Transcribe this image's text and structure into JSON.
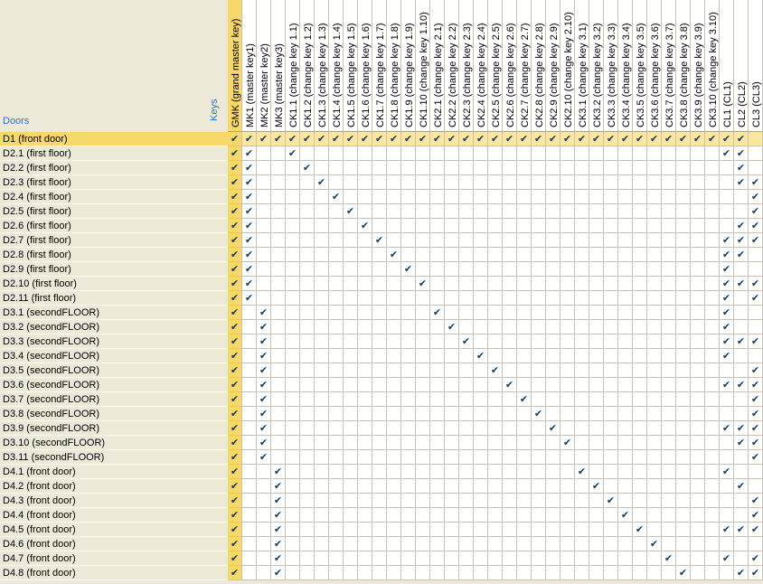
{
  "window": {
    "title": ""
  },
  "headers": {
    "doors_label": "Doors",
    "keys_label": "Keys"
  },
  "colors": {
    "accent": "#f6d86b",
    "header_text": "#2f73c4",
    "check": "#17385f"
  },
  "key_columns": [
    "GMK (grand master key)",
    "MK1 (master key1)",
    "MK2 (master key2)",
    "MK3 (master key3)",
    "CK1.1 (change key 1.1)",
    "CK1.2 (change key 1.2)",
    "CK1.3 (change key 1.3)",
    "CK1.4 (change key 1.4)",
    "CK1.5 (change key 1.5)",
    "CK1.6 (change key 1.6)",
    "CK1.7 (change key 1.7)",
    "CK1.8 (change key 1.8)",
    "CK1.9 (change key 1.9)",
    "CK1.10 (change key 1.10)",
    "CK2.1 (change key 2.1)",
    "CK2.2 (change key 2.2)",
    "CK2.3 (change key 2.3)",
    "CK2.4 (change key 2.4)",
    "CK2.5 (change key 2.5)",
    "CK2.6 (change key 2.6)",
    "CK2.7 (change key 2.7)",
    "CK2.8 (change key 2.8)",
    "CK2.9 (change key 2.9)",
    "CK2.10 (change key 2.10)",
    "CK3.1 (change key 3.1)",
    "CK3.2 (change key 3.2)",
    "CK3.3 (change key 3.3)",
    "CK3.4 (change key 3.4)",
    "CK3.5 (change key 3.5)",
    "CK3.6 (change key 3.6)",
    "CK3.7 (change key 3.7)",
    "CK3.8 (change key 3.8)",
    "CK3.9 (change key 3.9)",
    "CK3.10 (change key 3.10)",
    "CL1 (CL1)",
    "CL2 (CL2)",
    "CL3 (CL3)"
  ],
  "rows": [
    {
      "door": "D1 (front door)",
      "selected": true,
      "checks": [
        0,
        1,
        2,
        3,
        4,
        5,
        6,
        7,
        8,
        9,
        10,
        11,
        12,
        13,
        14,
        15,
        16,
        17,
        18,
        19,
        20,
        21,
        22,
        23,
        24,
        25,
        26,
        27,
        28,
        29,
        30,
        31,
        32,
        33,
        34,
        35
      ]
    },
    {
      "door": "D2.1 (first floor)",
      "checks": [
        0,
        1,
        4,
        34,
        35
      ]
    },
    {
      "door": "D2.2 (first floor)",
      "checks": [
        0,
        1,
        5,
        35
      ]
    },
    {
      "door": "D2.3 (first floor)",
      "checks": [
        0,
        1,
        6,
        35,
        36
      ]
    },
    {
      "door": "D2.4 (first floor)",
      "checks": [
        0,
        1,
        7,
        36
      ]
    },
    {
      "door": "D2.5 (first floor)",
      "checks": [
        0,
        1,
        8,
        36
      ]
    },
    {
      "door": "D2.6 (first floor)",
      "checks": [
        0,
        1,
        9,
        35,
        36
      ]
    },
    {
      "door": "D2.7 (first floor)",
      "checks": [
        0,
        1,
        10,
        34,
        35,
        36
      ]
    },
    {
      "door": "D2.8 (first floor)",
      "checks": [
        0,
        1,
        11,
        34,
        35
      ]
    },
    {
      "door": "D2.9 (first floor)",
      "checks": [
        0,
        1,
        12,
        34
      ]
    },
    {
      "door": "D2.10 (first floor)",
      "checks": [
        0,
        1,
        13,
        34,
        35,
        36
      ]
    },
    {
      "door": "D2.11 (first floor)",
      "checks": [
        0,
        1,
        34,
        36
      ]
    },
    {
      "door": "D3.1 (secondFLOOR)",
      "checks": [
        0,
        2,
        14,
        34
      ]
    },
    {
      "door": "D3.2 (secondFLOOR)",
      "checks": [
        0,
        2,
        15,
        34
      ]
    },
    {
      "door": "D3.3 (secondFLOOR)",
      "checks": [
        0,
        2,
        16,
        34,
        35,
        36
      ]
    },
    {
      "door": "D3.4 (secondFLOOR)",
      "checks": [
        0,
        2,
        17,
        34
      ]
    },
    {
      "door": "D3.5 (secondFLOOR)",
      "checks": [
        0,
        2,
        18,
        36
      ]
    },
    {
      "door": "D3.6 (secondFLOOR)",
      "checks": [
        0,
        2,
        19,
        34,
        35,
        36
      ]
    },
    {
      "door": "D3.7 (secondFLOOR)",
      "checks": [
        0,
        2,
        20,
        36
      ]
    },
    {
      "door": "D3.8 (secondFLOOR)",
      "checks": [
        0,
        2,
        21,
        36
      ]
    },
    {
      "door": "D3.9 (secondFLOOR)",
      "checks": [
        0,
        2,
        22,
        34,
        35,
        36
      ]
    },
    {
      "door": "D3.10 (secondFLOOR)",
      "checks": [
        0,
        2,
        23,
        35,
        36
      ]
    },
    {
      "door": "D3.11 (secondFLOOR)",
      "checks": [
        0,
        2,
        36
      ]
    },
    {
      "door": "D4.1 (front door)",
      "checks": [
        0,
        3,
        24,
        34
      ]
    },
    {
      "door": "D4.2 (front door)",
      "checks": [
        0,
        3,
        25,
        35
      ]
    },
    {
      "door": "D4.3 (front door)",
      "checks": [
        0,
        3,
        26,
        36
      ]
    },
    {
      "door": "D4.4 (front door)",
      "checks": [
        0,
        3,
        27,
        36
      ]
    },
    {
      "door": "D4.5 (front door)",
      "checks": [
        0,
        3,
        28,
        34,
        35,
        36
      ]
    },
    {
      "door": "D4.6 (front door)",
      "checks": [
        0,
        3,
        29
      ]
    },
    {
      "door": "D4.7 (front door)",
      "checks": [
        0,
        3,
        30,
        34,
        36
      ]
    },
    {
      "door": "D4.8 (front door)",
      "checks": [
        0,
        3,
        31,
        35,
        36
      ]
    }
  ]
}
